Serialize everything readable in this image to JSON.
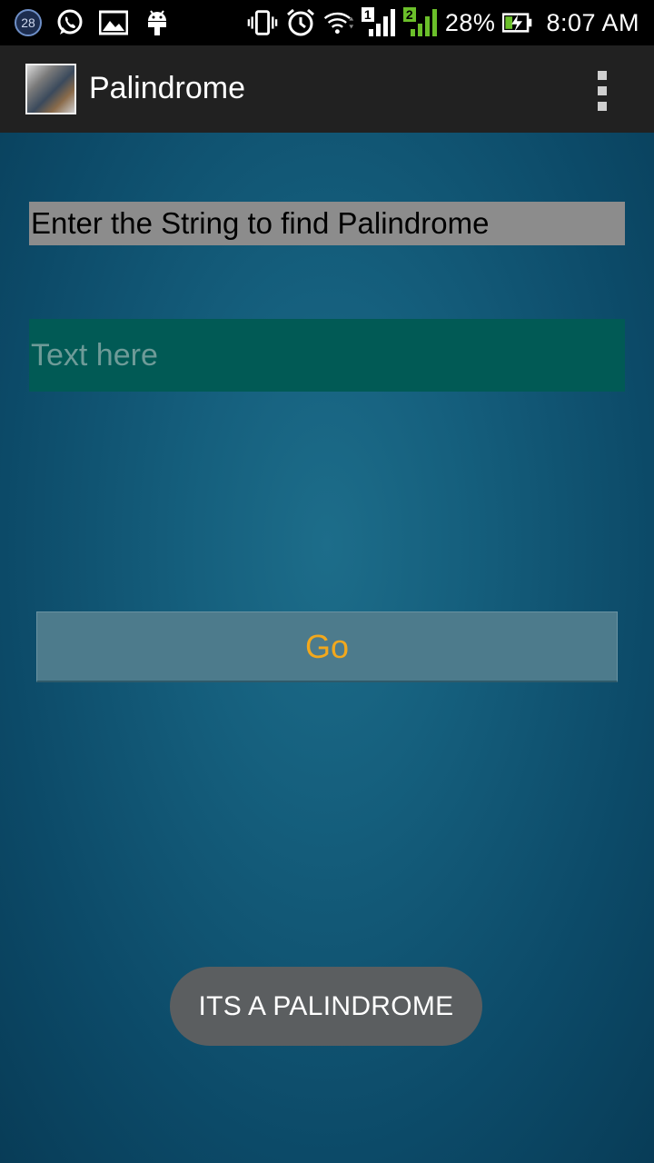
{
  "status_bar": {
    "notification_count": "28",
    "icons": [
      "whatsapp-icon",
      "gallery-icon",
      "android-icon",
      "vibrate-icon",
      "alarm-icon",
      "wifi-icon",
      "signal-sim1-icon",
      "signal-sim2-icon",
      "battery-charging-icon"
    ],
    "sim1_label": "1",
    "sim2_label": "2",
    "battery": "28%",
    "time": "8:07 AM"
  },
  "action_bar": {
    "title": "Palindrome",
    "overflow_icon": "overflow-menu-icon"
  },
  "main": {
    "prompt": "Enter the String to find Palindrome",
    "input_placeholder": "Text here",
    "input_value": "",
    "go_label": "Go"
  },
  "toast": {
    "message": "ITS A PALINDROME"
  },
  "colors": {
    "label_bg": "#8c8c8c",
    "input_bg": "#015a55",
    "button_bg": "#4d7b8c",
    "button_text": "#f2a81d",
    "toast_bg": "#5b5e60",
    "action_bar_bg": "#212121"
  }
}
